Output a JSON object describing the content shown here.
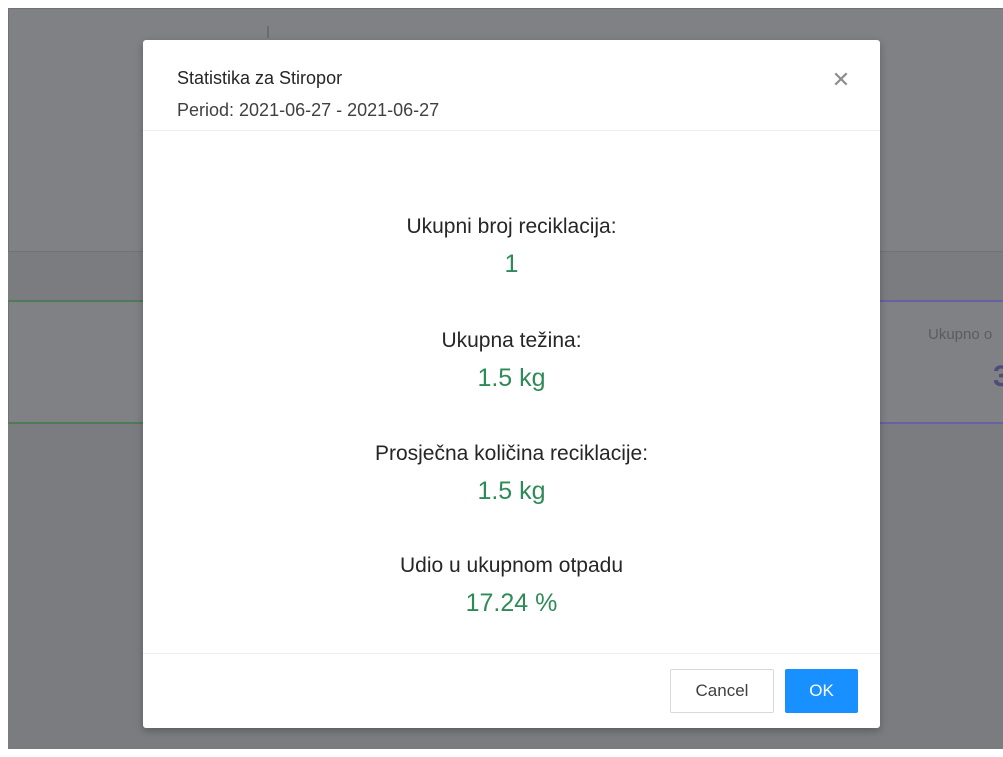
{
  "background": {
    "partial_label": "Ukupno o",
    "partial_value": "3"
  },
  "modal": {
    "title": "Statistika za Stiropor",
    "period": "Period: 2021-06-27 - 2021-06-27",
    "close_icon": "close-icon",
    "close_glyph": "✕",
    "stats": [
      {
        "label": "Ukupni broj reciklacija:",
        "value": "1"
      },
      {
        "label": "Ukupna težina:",
        "value": "1.5 kg"
      },
      {
        "label": "Prosječna količina reciklacije:",
        "value": "1.5 kg"
      },
      {
        "label": "Udio u ukupnom otpadu",
        "value": "17.24 %"
      }
    ],
    "value_color": "#2e8b57",
    "buttons": {
      "cancel": "Cancel",
      "ok": "OK"
    },
    "primary_color": "#1890ff"
  }
}
